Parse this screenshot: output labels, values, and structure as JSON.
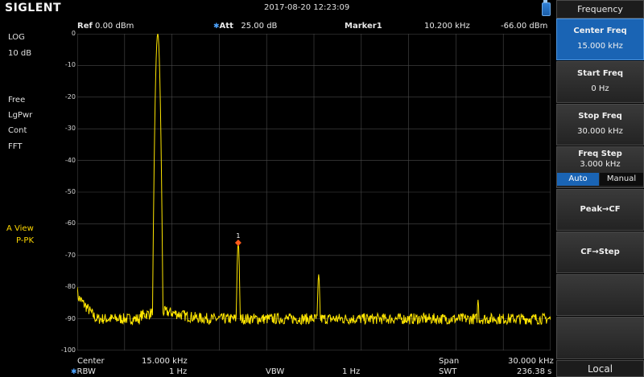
{
  "brand": "SIGLENT",
  "datetime": "2017-08-20   12:23:09",
  "header": {
    "ref_label": "Ref",
    "ref_value": "0.00 dBm",
    "att_label": "Att",
    "att_value": "25.00 dB",
    "marker_label": "Marker1",
    "marker_freq": "10.200 kHz",
    "marker_level": "-66.00 dBm"
  },
  "left_status": {
    "scale_type": "LOG",
    "scale_div": "10 dB",
    "trig": "Free",
    "det": "LgPwr",
    "sweep": "Cont",
    "mode": "FFT",
    "trace_view": "A View",
    "trace_det": "P-PK"
  },
  "y_ticks": [
    "0",
    "-10",
    "-20",
    "-30",
    "-40",
    "-50",
    "-60",
    "-70",
    "-80",
    "-90",
    "-100"
  ],
  "bottom": {
    "center_label": "Center",
    "center_value": "15.000 kHz",
    "rbw_label": "RBW",
    "rbw_value": "1 Hz",
    "vbw_label": "VBW",
    "vbw_value": "1 Hz",
    "span_label": "Span",
    "span_value": "30.000 kHz",
    "swt_label": "SWT",
    "swt_value": "236.38 s"
  },
  "marker_number": "1",
  "softkeys": {
    "title": "Frequency",
    "center_freq": {
      "label": "Center Freq",
      "value": "15.000 kHz"
    },
    "start_freq": {
      "label": "Start Freq",
      "value": "0 Hz"
    },
    "stop_freq": {
      "label": "Stop Freq",
      "value": "30.000 kHz"
    },
    "freq_step": {
      "label": "Freq Step",
      "value": "3.000 kHz",
      "auto": "Auto",
      "manual": "Manual"
    },
    "peak_cf": "Peak→CF",
    "cf_step": "CF→Step",
    "local": "Local"
  },
  "colors": {
    "trace": "#ffe600",
    "marker": "#ff5a1a",
    "active_key": "#1a64b4",
    "grid": "#4a4a4a"
  },
  "chart_data": {
    "type": "line",
    "x_unit": "kHz",
    "y_unit": "dBm",
    "xlim": [
      0,
      30
    ],
    "ylim": [
      -100,
      0
    ],
    "grid": true,
    "noise_floor_db": -90,
    "peaks": [
      {
        "x": 0.0,
        "y": -80
      },
      {
        "x": 5.1,
        "y": 0
      },
      {
        "x": 10.2,
        "y": -66
      },
      {
        "x": 15.3,
        "y": -76
      },
      {
        "x": 25.4,
        "y": -84
      }
    ],
    "marker": {
      "x": 10.2,
      "y": -66
    }
  }
}
